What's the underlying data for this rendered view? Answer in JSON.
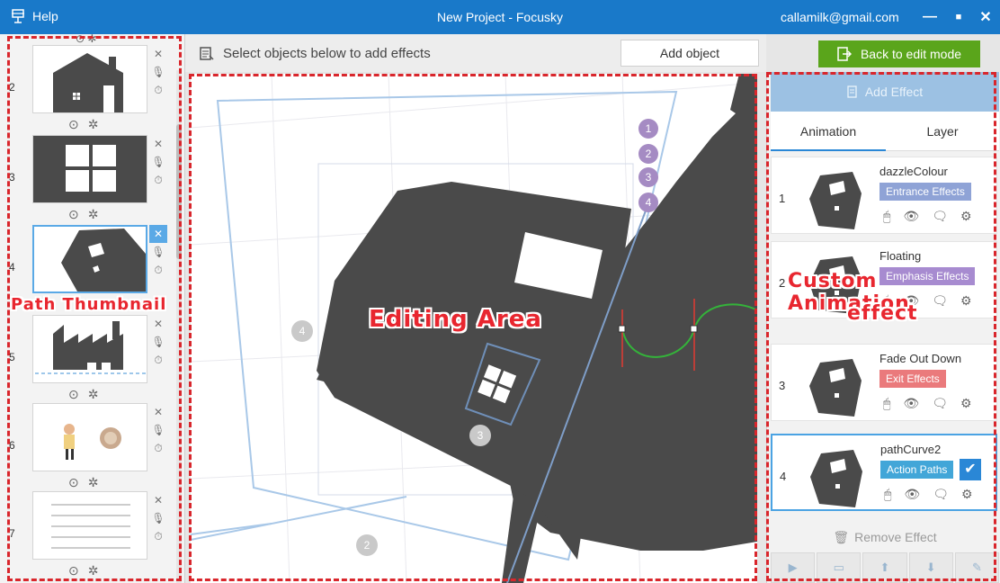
{
  "titlebar": {
    "help": "Help",
    "title": "New Project - Focusky",
    "email": "callamilk@gmail.com",
    "minimize": "—",
    "maximize": "■",
    "close": "✕"
  },
  "toolbar": {
    "hint": "Select objects below to add effects",
    "add_object": "Add object",
    "back": "Back to edit mode"
  },
  "paths": [
    {
      "num": "2"
    },
    {
      "num": "3"
    },
    {
      "num": "4"
    },
    {
      "num": "5"
    },
    {
      "num": "6"
    },
    {
      "num": "7"
    }
  ],
  "canvas": {
    "badges": [
      "1",
      "2",
      "3",
      "4"
    ],
    "circles": [
      "4",
      "3",
      "2"
    ]
  },
  "right": {
    "add_effect": "Add Effect",
    "tabs": [
      "Animation",
      "Layer"
    ],
    "effects": [
      {
        "num": "1",
        "name": "dazzleColour",
        "tag": "Entrance Effects",
        "color": "#8fa3d6"
      },
      {
        "num": "2",
        "name": "Floating",
        "tag": "Emphasis Effects",
        "color": "#a78bd0"
      },
      {
        "num": "3",
        "name": "Fade Out Down",
        "tag": "Exit Effects",
        "color": "#ea7a7c"
      },
      {
        "num": "4",
        "name": "pathCurve2",
        "tag": "Action Paths",
        "color": "#42a6d8"
      }
    ],
    "remove_effect": "Remove Effect"
  },
  "annotations": {
    "path_thumbnail": "Path Thumbnail",
    "editing_area": "Editing Area",
    "custom_animation": "Custom Animation",
    "effect": "effect"
  },
  "icons": [
    "app-icon",
    "list-icon",
    "exit-icon",
    "play-icon",
    "gear-icon",
    "mic-icon",
    "timer-icon",
    "mouse-icon",
    "eye-icon",
    "comment-icon",
    "settings-icon",
    "trash-icon",
    "arrow-up-icon",
    "arrow-down-icon",
    "brush-icon",
    "present-icon"
  ]
}
